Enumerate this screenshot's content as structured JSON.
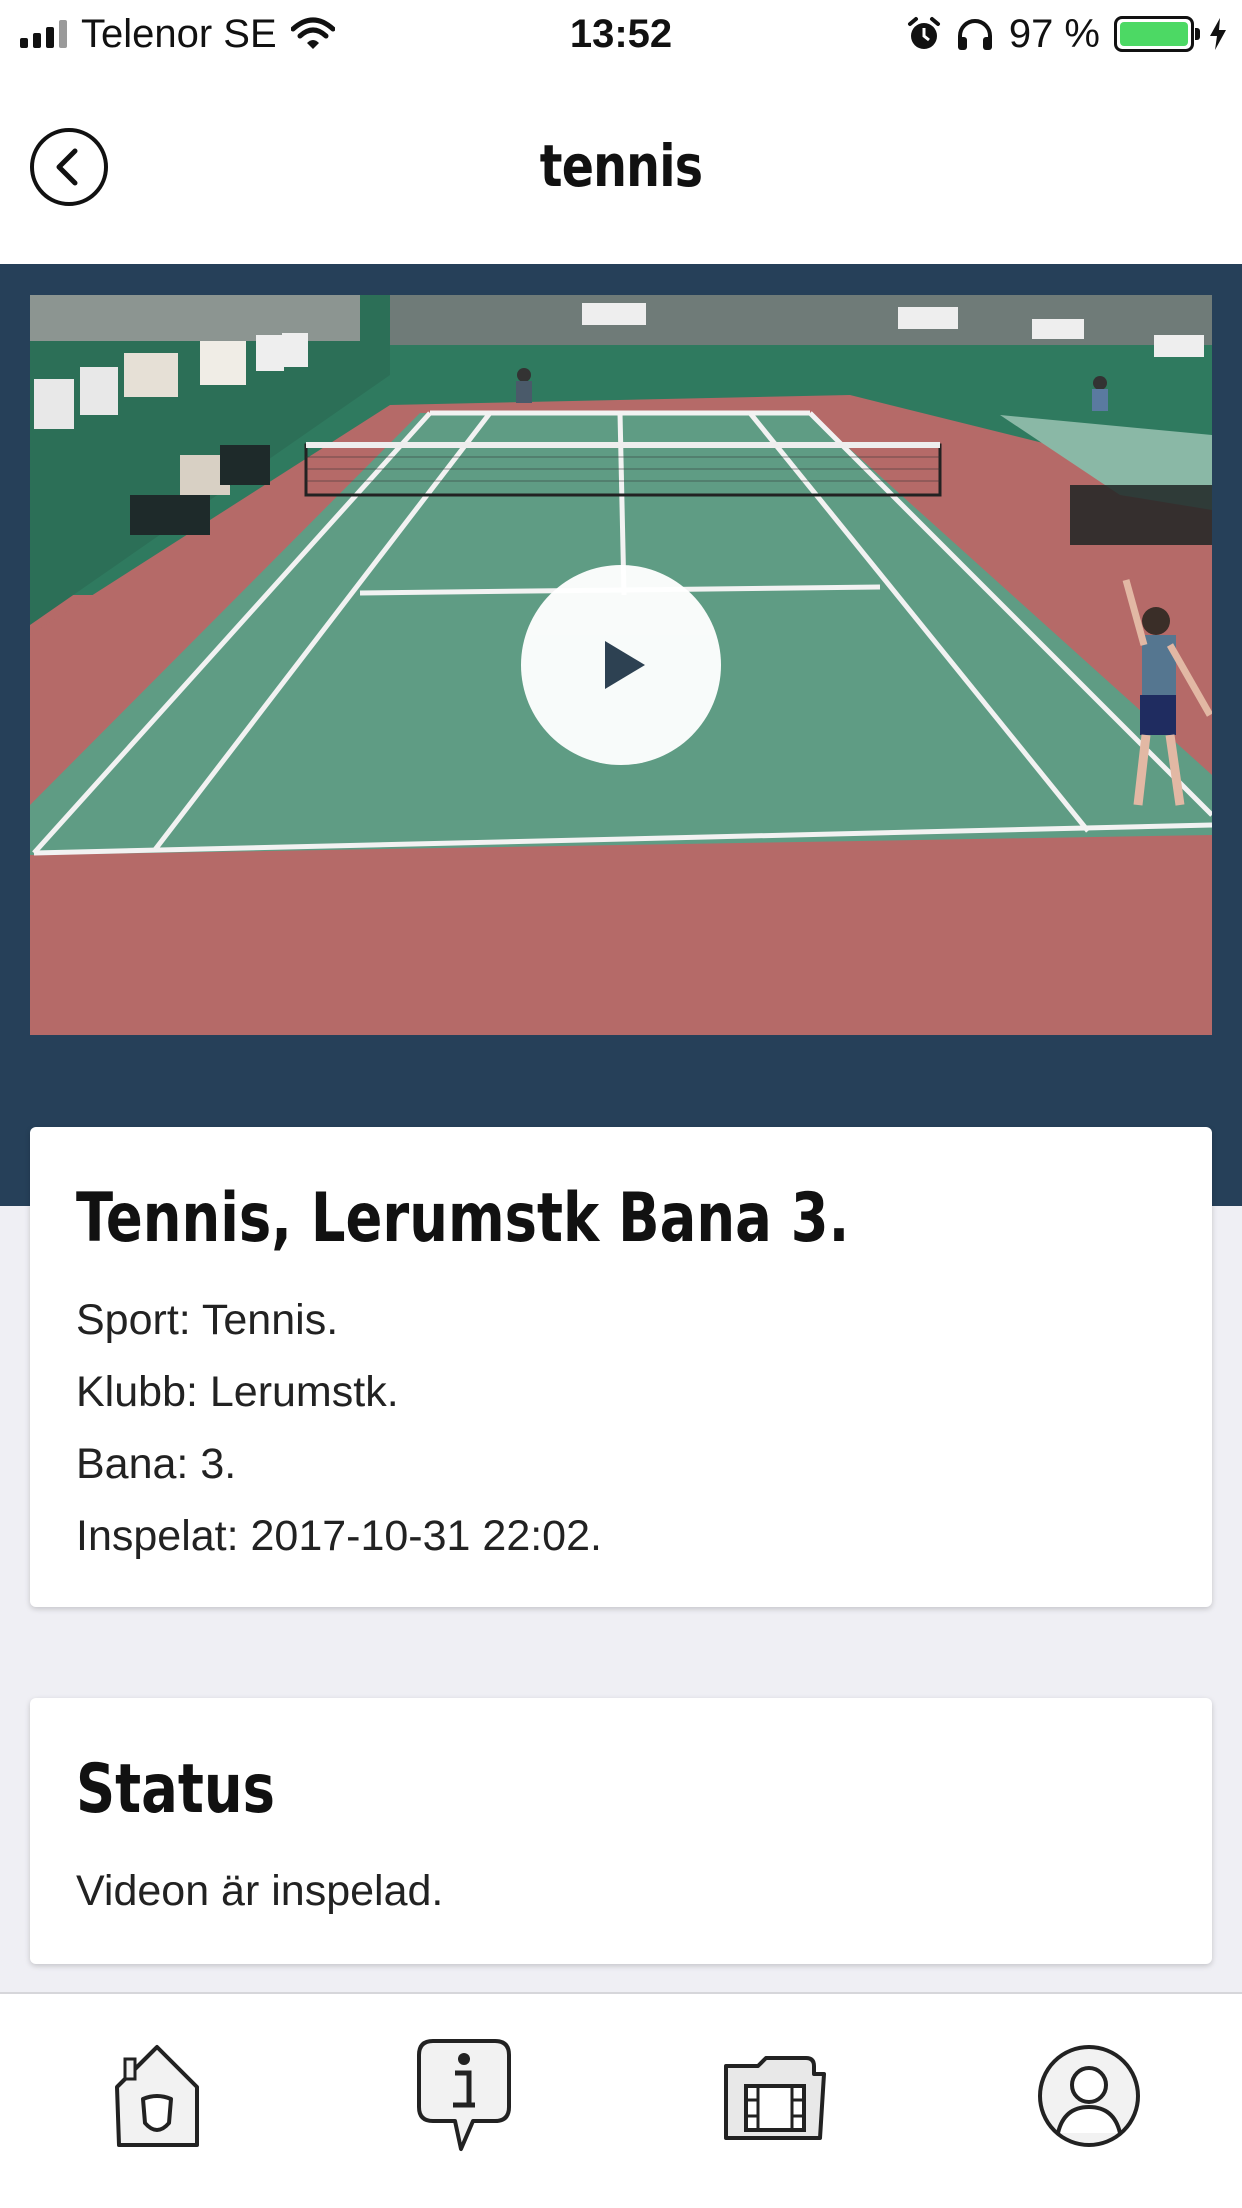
{
  "status_bar": {
    "carrier": "Telenor SE",
    "time": "13:52",
    "battery": "97 %",
    "icons": [
      "signal-icon",
      "wifi-icon",
      "alarm-icon",
      "headphones-icon",
      "battery-icon",
      "charging-icon"
    ]
  },
  "nav": {
    "title": "tennis",
    "back_icon": "back-chevron-icon"
  },
  "video": {
    "play_icon": "play-icon"
  },
  "info_card": {
    "title": "Tennis, Lerumstk Bana 3.",
    "lines": [
      "Sport: Tennis.",
      "Klubb: Lerumstk.",
      "Bana: 3.",
      "Inspelat: 2017-10-31 22:02."
    ]
  },
  "status_card": {
    "title": "Status",
    "text": "Videon är inspelad."
  },
  "tab_bar": {
    "items": [
      "home-shield-icon",
      "info-bubble-icon",
      "video-folder-icon",
      "profile-icon"
    ]
  },
  "colors": {
    "band": "#264059",
    "battery_fill": "#4cd964",
    "court_green": "#5f9c84",
    "court_clay": "#b56a68"
  }
}
